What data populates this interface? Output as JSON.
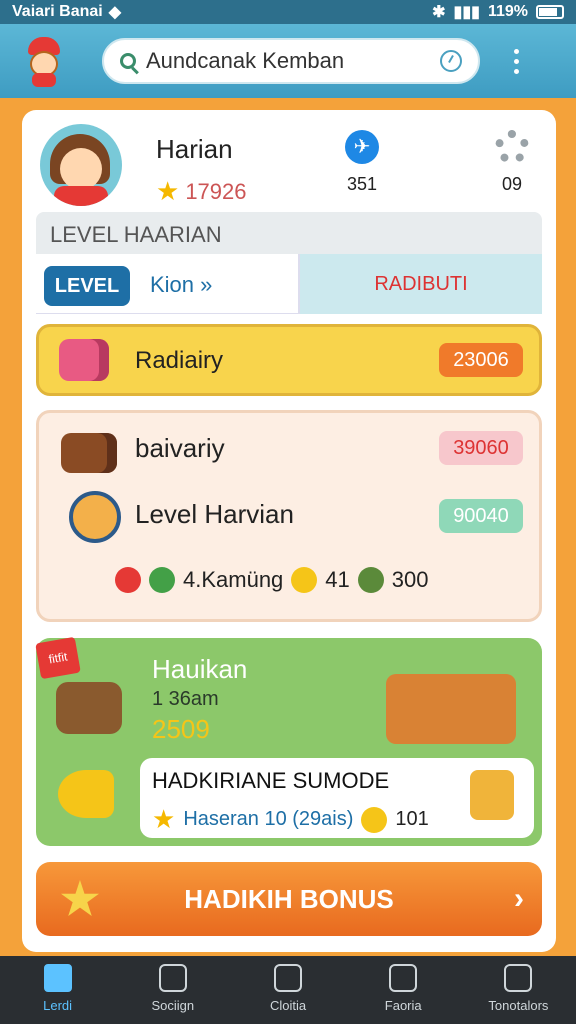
{
  "status_bar": {
    "carrier": "Vaiari Banai",
    "battery": "119%"
  },
  "search": {
    "value": "Aundcanak Kemban"
  },
  "profile": {
    "name": "Harian",
    "points": "17926",
    "stat_a": "351",
    "stat_b": "09"
  },
  "level": {
    "heading": "LEVEL HAARIAN",
    "badge": "LEVEL",
    "link": "Kion »",
    "right": "RADIBUTI"
  },
  "reward_bar": {
    "label": "Radiairy",
    "value": "23006"
  },
  "panel": {
    "label_1": "baivariy",
    "value_1": "39060",
    "label_2": "Level Harvian",
    "value_2": "90040",
    "stat_text": "4.Kamüng",
    "stat_2": "41",
    "stat_3": "300"
  },
  "promo": {
    "ribbon": "fitfit",
    "title": "Hauikan",
    "sub": "1 36am",
    "score": "2509",
    "inner_title": "HADKIRIANE SUMODE",
    "inner_line": "Haseran 10 (29ais)",
    "inner_tail": "101"
  },
  "bonus_button": {
    "label": "HADIKIH BONUS"
  },
  "bottom_nav": [
    {
      "label": "Lerdi"
    },
    {
      "label": "Sociign"
    },
    {
      "label": "Cloitia"
    },
    {
      "label": "Faoria"
    },
    {
      "label": "Tonotalors"
    }
  ]
}
